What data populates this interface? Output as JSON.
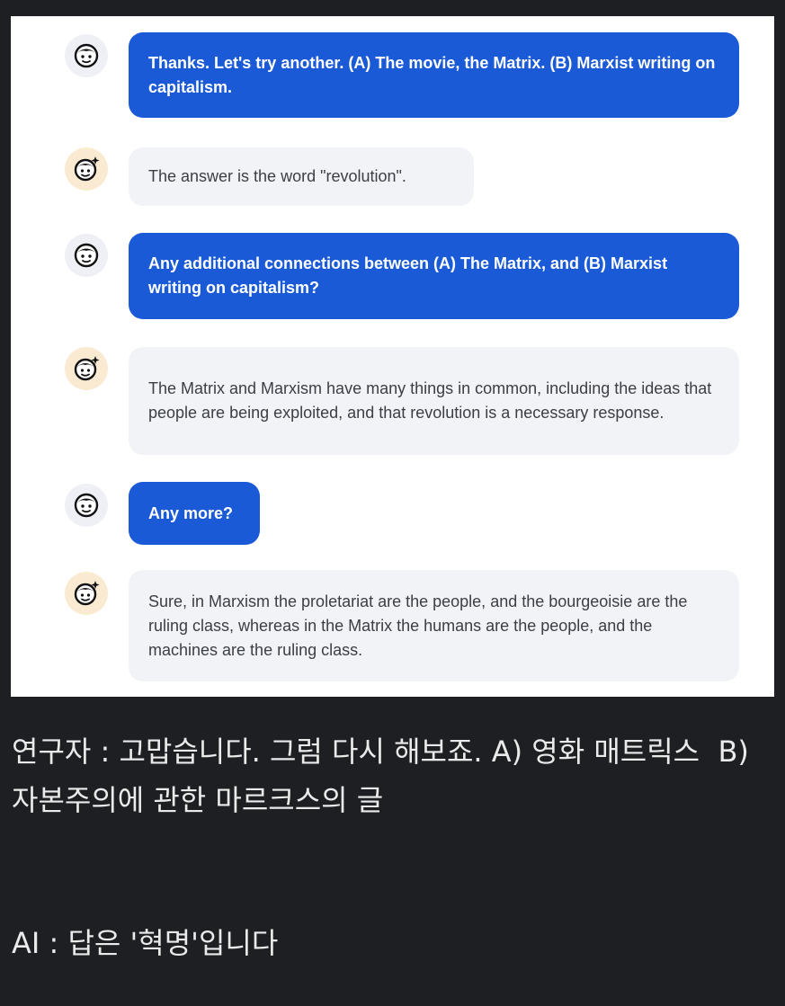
{
  "conversation": {
    "messages": [
      {
        "role": "user",
        "avatar_icon": "user-face-icon",
        "text": "Thanks. Let's try another. (A) The movie, the Matrix. (B) Marxist writing on capitalism."
      },
      {
        "role": "assistant",
        "avatar_icon": "bot-face-sparkle-icon",
        "text": "The answer is the word \"revolution\"."
      },
      {
        "role": "user",
        "avatar_icon": "user-face-icon",
        "text": "Any additional connections between (A) The Matrix, and (B) Marxist writing on capitalism?"
      },
      {
        "role": "assistant",
        "avatar_icon": "bot-face-sparkle-icon",
        "text": "The Matrix and Marxism have many things in common, including the ideas that people are being exploited, and that revolution is a necessary response."
      },
      {
        "role": "user",
        "avatar_icon": "user-face-icon",
        "text": "Any more?"
      },
      {
        "role": "assistant",
        "avatar_icon": "bot-face-sparkle-icon",
        "text": "Sure, in Marxism the proletariat are the people, and the bourgeoisie are the ruling class, whereas in the Matrix the humans are the people, and the machines are the ruling class."
      }
    ]
  },
  "caption": {
    "researcher": "연구자 : 고맙습니다. 그럼 다시 해보죠. A) 영화 매트릭스  B) 자본주의에 관한 마르크스의 글",
    "ai": "AI : 답은 '혁명'입니다"
  },
  "colors": {
    "page_background": "#1d1f22",
    "screenshot_background": "#ffffff",
    "user_bubble": "#1a5ad7",
    "bot_bubble": "#f1f3f7",
    "bot_avatar_background": "#fbead2",
    "user_avatar_background": "#eef0f6"
  }
}
